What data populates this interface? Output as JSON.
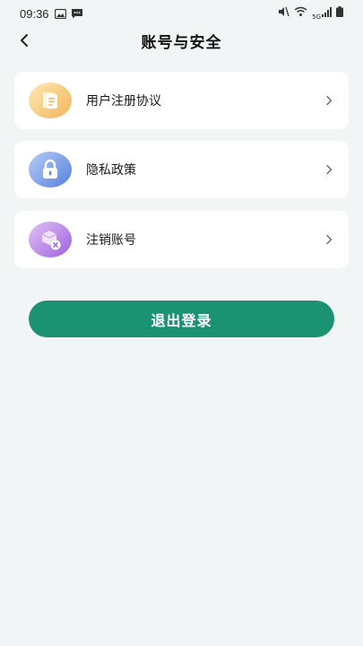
{
  "status_bar": {
    "time": "09:36",
    "network_label": "5G"
  },
  "header": {
    "title": "账号与安全"
  },
  "menu": [
    {
      "label": "用户注册协议",
      "icon": "document-icon",
      "icon_gradient": [
        "#fde5a8",
        "#f2b960"
      ]
    },
    {
      "label": "隐私政策",
      "icon": "lock-icon",
      "icon_gradient": [
        "#a9c2f5",
        "#5c86e0"
      ]
    },
    {
      "label": "注销账号",
      "icon": "cancel-account-icon",
      "icon_gradient": [
        "#dcb7f5",
        "#a36be0"
      ]
    }
  ],
  "logout": {
    "label": "退出登录",
    "color": "#1b9272"
  }
}
